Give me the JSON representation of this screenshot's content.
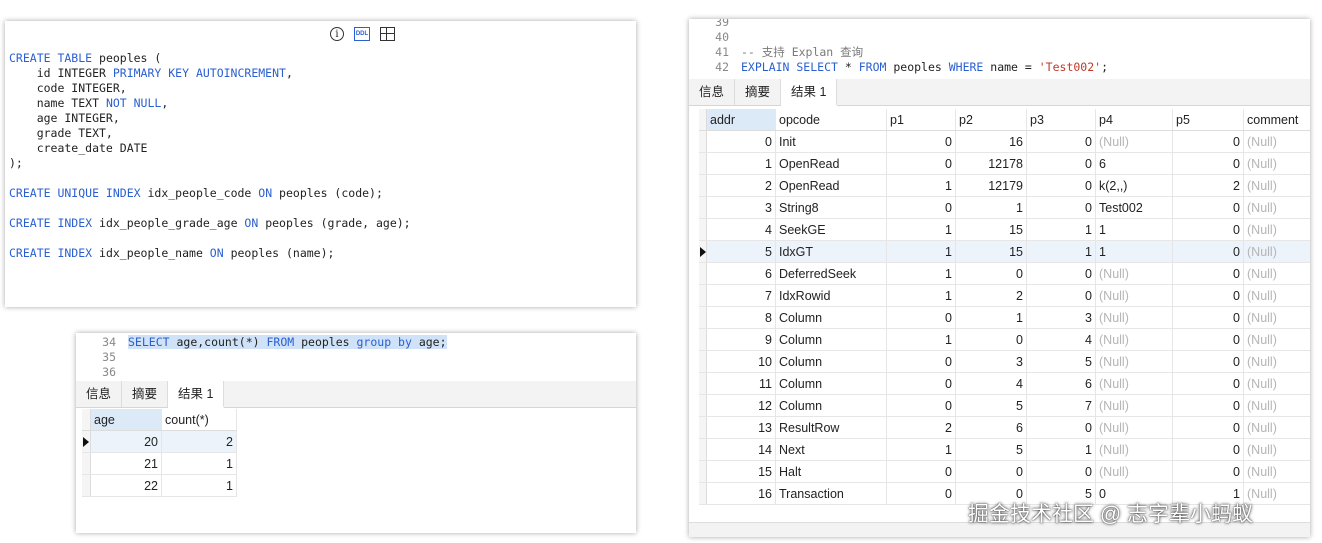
{
  "ddl_panel": {
    "toolbar_icons": [
      "info-icon",
      "ddl-icon",
      "grid-layout-icon"
    ],
    "ddl_icon_label": "DDL",
    "info_glyph": "i",
    "lines": [
      [
        {
          "t": "CREATE TABLE",
          "k": "kw"
        },
        {
          "t": " peoples ("
        }
      ],
      [
        {
          "t": "    id INTEGER "
        },
        {
          "t": "PRIMARY KEY AUTOINCREMENT",
          "k": "kw"
        },
        {
          "t": ","
        }
      ],
      [
        {
          "t": "    code INTEGER,"
        }
      ],
      [
        {
          "t": "    name TEXT "
        },
        {
          "t": "NOT NULL",
          "k": "kw"
        },
        {
          "t": ","
        }
      ],
      [
        {
          "t": "    age INTEGER,"
        }
      ],
      [
        {
          "t": "    grade TEXT,"
        }
      ],
      [
        {
          "t": "    create_date DATE"
        }
      ],
      [
        {
          "t": ");"
        }
      ],
      [
        {
          "t": ""
        }
      ],
      [
        {
          "t": "CREATE UNIQUE INDEX",
          "k": "kw"
        },
        {
          "t": " idx_people_code "
        },
        {
          "t": "ON",
          "k": "kw"
        },
        {
          "t": " peoples (code);"
        }
      ],
      [
        {
          "t": ""
        }
      ],
      [
        {
          "t": "CREATE INDEX",
          "k": "kw"
        },
        {
          "t": " idx_people_grade_age "
        },
        {
          "t": "ON",
          "k": "kw"
        },
        {
          "t": " peoples (grade, age);"
        }
      ],
      [
        {
          "t": ""
        }
      ],
      [
        {
          "t": "CREATE INDEX",
          "k": "kw"
        },
        {
          "t": " idx_people_name "
        },
        {
          "t": "ON",
          "k": "kw"
        },
        {
          "t": " peoples (name);"
        }
      ]
    ]
  },
  "groupby_panel": {
    "editor": [
      {
        "ln": "34",
        "parts": [
          {
            "t": "SELECT",
            "k": "kw"
          },
          {
            "t": " age,count(*) "
          },
          {
            "t": "FROM",
            "k": "kw"
          },
          {
            "t": " peoples "
          },
          {
            "t": "group by",
            "k": "kw"
          },
          {
            "t": " age;"
          }
        ],
        "selected": true
      },
      {
        "ln": "35",
        "parts": []
      },
      {
        "ln": "36",
        "parts": []
      }
    ],
    "tabs": [
      "信息",
      "摘要",
      "结果 1"
    ],
    "active_tab": 2,
    "columns": [
      "age",
      "count(*)"
    ],
    "rows": [
      [
        "20",
        "2"
      ],
      [
        "21",
        "1"
      ],
      [
        "22",
        "1"
      ]
    ],
    "current_row": 0
  },
  "explain_panel": {
    "editor": [
      {
        "ln": "39",
        "parts": []
      },
      {
        "ln": "40",
        "parts": []
      },
      {
        "ln": "41",
        "parts": [
          {
            "t": "-- 支持 Explan 查询",
            "k": "cm"
          }
        ]
      },
      {
        "ln": "42",
        "parts": [
          {
            "t": "EXPLAIN SELECT",
            "k": "kw"
          },
          {
            "t": " * "
          },
          {
            "t": "FROM",
            "k": "kw"
          },
          {
            "t": " peoples "
          },
          {
            "t": "WHERE",
            "k": "kw"
          },
          {
            "t": " name = "
          },
          {
            "t": "'Test002'",
            "k": "str"
          },
          {
            "t": ";"
          }
        ]
      }
    ],
    "tabs": [
      "信息",
      "摘要",
      "结果 1"
    ],
    "active_tab": 2,
    "columns": [
      "addr",
      "opcode",
      "p1",
      "p2",
      "p3",
      "p4",
      "p5",
      "comment"
    ],
    "rows": [
      [
        "0",
        "Init",
        "0",
        "16",
        "0",
        "(Null)",
        "0",
        "(Null)"
      ],
      [
        "1",
        "OpenRead",
        "0",
        "12178",
        "0",
        "6",
        "0",
        "(Null)"
      ],
      [
        "2",
        "OpenRead",
        "1",
        "12179",
        "0",
        "k(2,,)",
        "2",
        "(Null)"
      ],
      [
        "3",
        "String8",
        "0",
        "1",
        "0",
        "Test002",
        "0",
        "(Null)"
      ],
      [
        "4",
        "SeekGE",
        "1",
        "15",
        "1",
        "1",
        "0",
        "(Null)"
      ],
      [
        "5",
        "IdxGT",
        "1",
        "15",
        "1",
        "1",
        "0",
        "(Null)"
      ],
      [
        "6",
        "DeferredSeek",
        "1",
        "0",
        "0",
        "(Null)",
        "0",
        "(Null)"
      ],
      [
        "7",
        "IdxRowid",
        "1",
        "2",
        "0",
        "(Null)",
        "0",
        "(Null)"
      ],
      [
        "8",
        "Column",
        "0",
        "1",
        "3",
        "(Null)",
        "0",
        "(Null)"
      ],
      [
        "9",
        "Column",
        "1",
        "0",
        "4",
        "(Null)",
        "0",
        "(Null)"
      ],
      [
        "10",
        "Column",
        "0",
        "3",
        "5",
        "(Null)",
        "0",
        "(Null)"
      ],
      [
        "11",
        "Column",
        "0",
        "4",
        "6",
        "(Null)",
        "0",
        "(Null)"
      ],
      [
        "12",
        "Column",
        "0",
        "5",
        "7",
        "(Null)",
        "0",
        "(Null)"
      ],
      [
        "13",
        "ResultRow",
        "2",
        "6",
        "0",
        "(Null)",
        "0",
        "(Null)"
      ],
      [
        "14",
        "Next",
        "1",
        "5",
        "1",
        "(Null)",
        "0",
        "(Null)"
      ],
      [
        "15",
        "Halt",
        "0",
        "0",
        "0",
        "(Null)",
        "0",
        "(Null)"
      ],
      [
        "16",
        "Transaction",
        "0",
        "0",
        "5",
        "0",
        "1",
        "(Null)"
      ]
    ],
    "current_row": 5
  },
  "watermark": "掘金技术社区 @ 志字辈小蚂蚁"
}
